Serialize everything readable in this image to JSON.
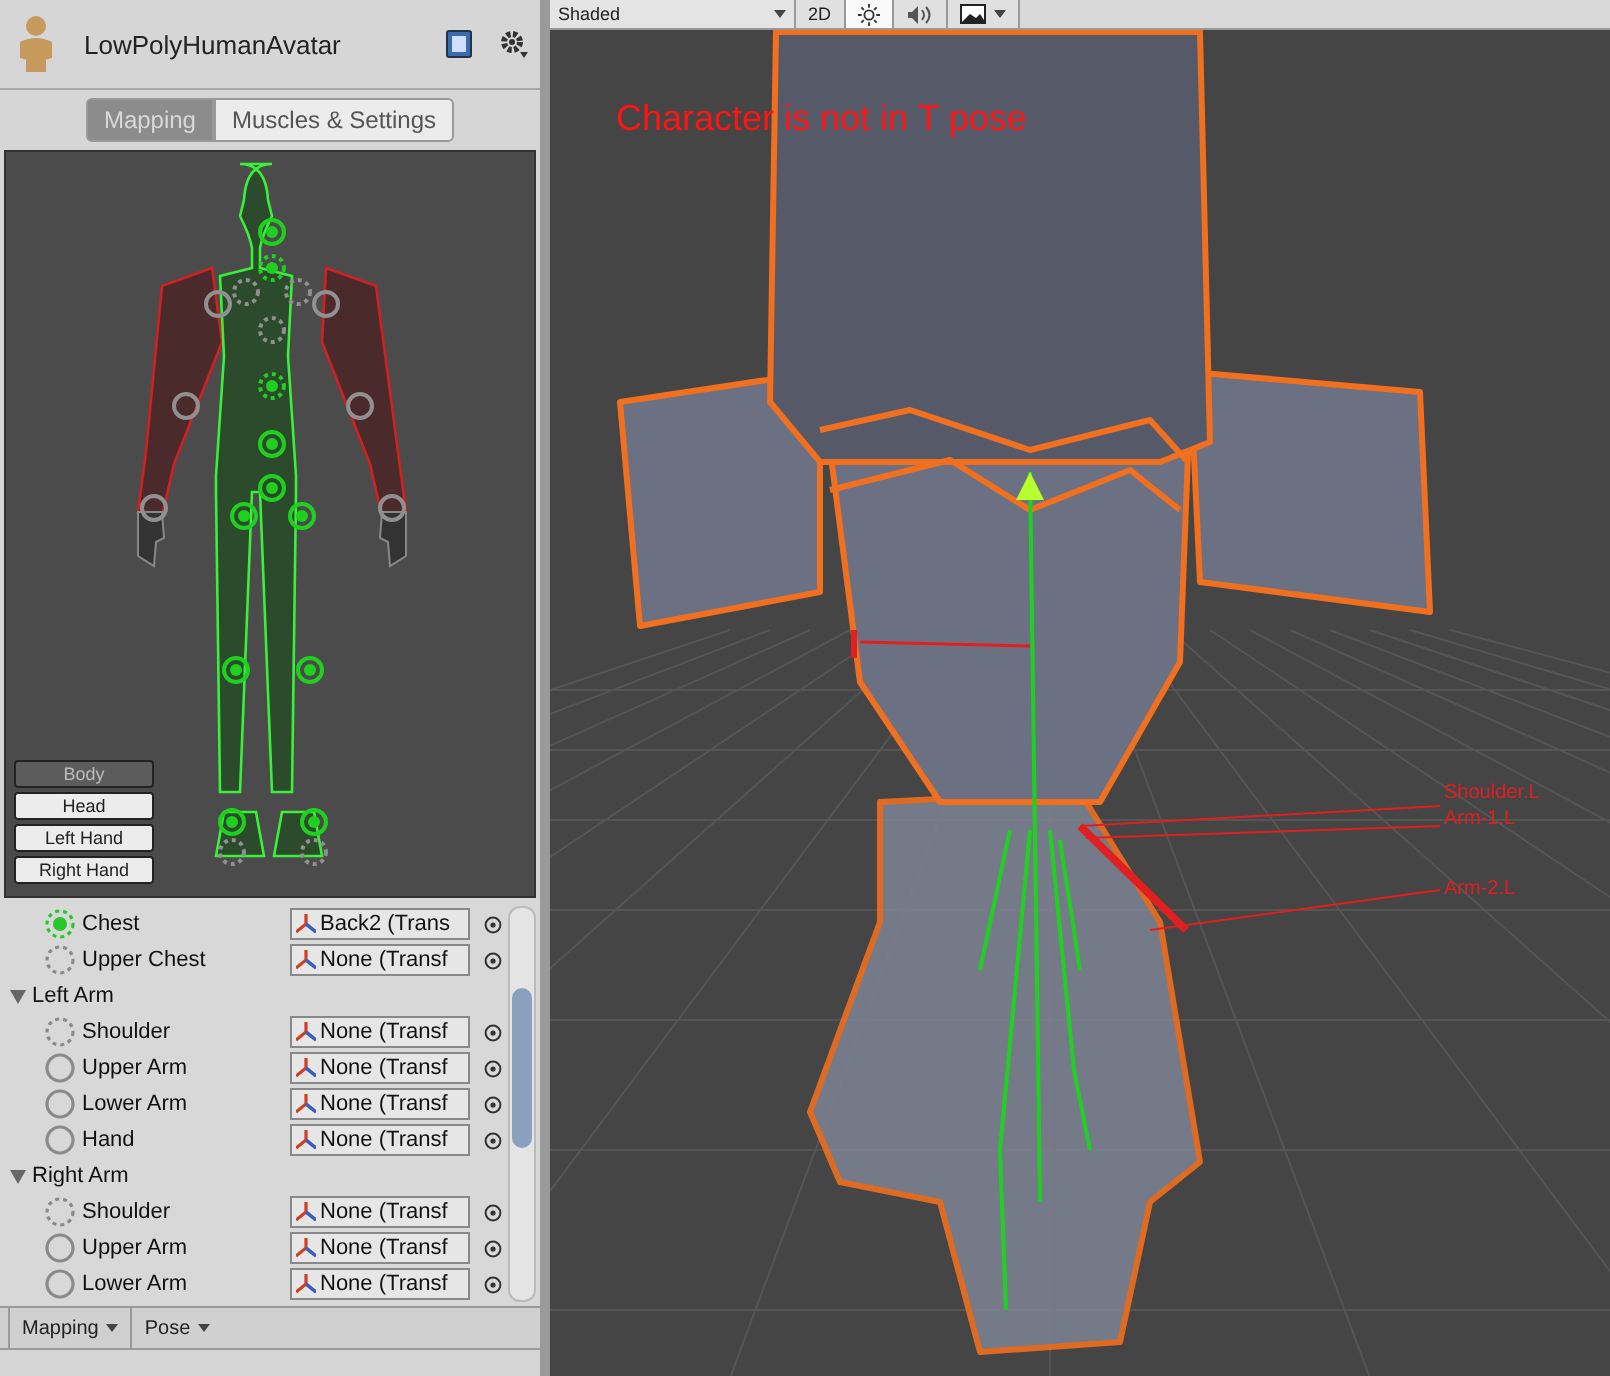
{
  "inspector": {
    "title": "LowPolyHumanAvatar",
    "tabs": [
      {
        "label": "Mapping",
        "selected": true
      },
      {
        "label": "Muscles & Settings",
        "selected": false
      }
    ],
    "part_buttons": [
      {
        "label": "Body",
        "selected": true
      },
      {
        "label": "Head",
        "selected": false
      },
      {
        "label": "Left Hand",
        "selected": false
      },
      {
        "label": "Right Hand",
        "selected": false
      }
    ],
    "rows": [
      {
        "kind": "bone",
        "label": "Chest",
        "optional": true,
        "mapped": true,
        "value": "Back2 (Trans"
      },
      {
        "kind": "bone",
        "label": "Upper Chest",
        "optional": true,
        "mapped": false,
        "value": "None (Transf"
      },
      {
        "kind": "group",
        "label": "Left Arm",
        "expanded": true
      },
      {
        "kind": "bone",
        "label": "Shoulder",
        "optional": true,
        "mapped": false,
        "value": "None (Transf"
      },
      {
        "kind": "bone",
        "label": "Upper Arm",
        "optional": false,
        "mapped": false,
        "value": "None (Transf"
      },
      {
        "kind": "bone",
        "label": "Lower Arm",
        "optional": false,
        "mapped": false,
        "value": "None (Transf"
      },
      {
        "kind": "bone",
        "label": "Hand",
        "optional": false,
        "mapped": false,
        "value": "None (Transf"
      },
      {
        "kind": "group",
        "label": "Right Arm",
        "expanded": true
      },
      {
        "kind": "bone",
        "label": "Shoulder",
        "optional": true,
        "mapped": false,
        "value": "None (Transf"
      },
      {
        "kind": "bone",
        "label": "Upper Arm",
        "optional": false,
        "mapped": false,
        "value": "None (Transf"
      },
      {
        "kind": "bone",
        "label": "Lower Arm",
        "optional": false,
        "mapped": false,
        "value": "None (Transf"
      }
    ],
    "footer_menus": [
      "Mapping",
      "Pose"
    ]
  },
  "scene_view": {
    "draw_mode": "Shaded",
    "toolbar": [
      {
        "kind": "text",
        "label": "2D",
        "selected": false
      },
      {
        "kind": "light",
        "selected": true
      },
      {
        "kind": "audio",
        "selected": false
      },
      {
        "kind": "effects",
        "selected": false
      }
    ],
    "warning": "Character is not in T pose",
    "bone_labels": [
      "Shoulder.L",
      "Arm-1.L",
      "Arm-2.L"
    ]
  }
}
